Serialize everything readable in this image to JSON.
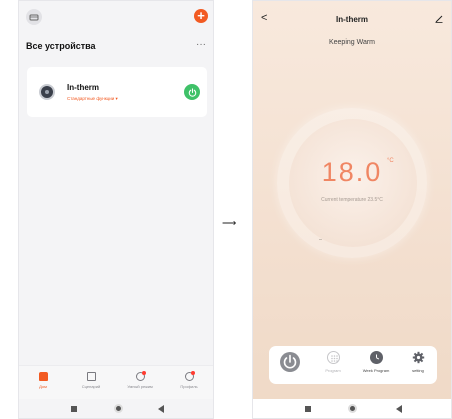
{
  "left_screen": {
    "header_title": "Все устройства",
    "more_label": "···",
    "add_button_label": "+",
    "device": {
      "name": "In-therm",
      "subtitle": "Стандартные функции ▾"
    },
    "tabs": [
      {
        "label": "Дом",
        "icon": "home-icon",
        "active": true
      },
      {
        "label": "Сценарий",
        "icon": "scene-icon",
        "active": false
      },
      {
        "label": "Умный режим",
        "icon": "smart-icon",
        "active": false
      },
      {
        "label": "Профиль",
        "icon": "profile-icon",
        "active": false
      }
    ]
  },
  "arrow": "⟶",
  "right_screen": {
    "back_label": "<",
    "title": "In-therm",
    "mode": "Keeping Warm",
    "temperature": "18.0",
    "unit": "°C",
    "current_temperature": "Current temperature 23.5°C",
    "controls": [
      {
        "label": "",
        "icon": "power-icon"
      },
      {
        "label": "Program",
        "icon": "program-icon"
      },
      {
        "label": "Week Program",
        "icon": "week-program-icon"
      },
      {
        "label": "setting",
        "icon": "gear-icon"
      }
    ]
  },
  "colors": {
    "accent": "#f25a22",
    "power_green": "#3fc168",
    "temperature": "#f08663",
    "thermostat_bg": "#f3dfcf"
  }
}
